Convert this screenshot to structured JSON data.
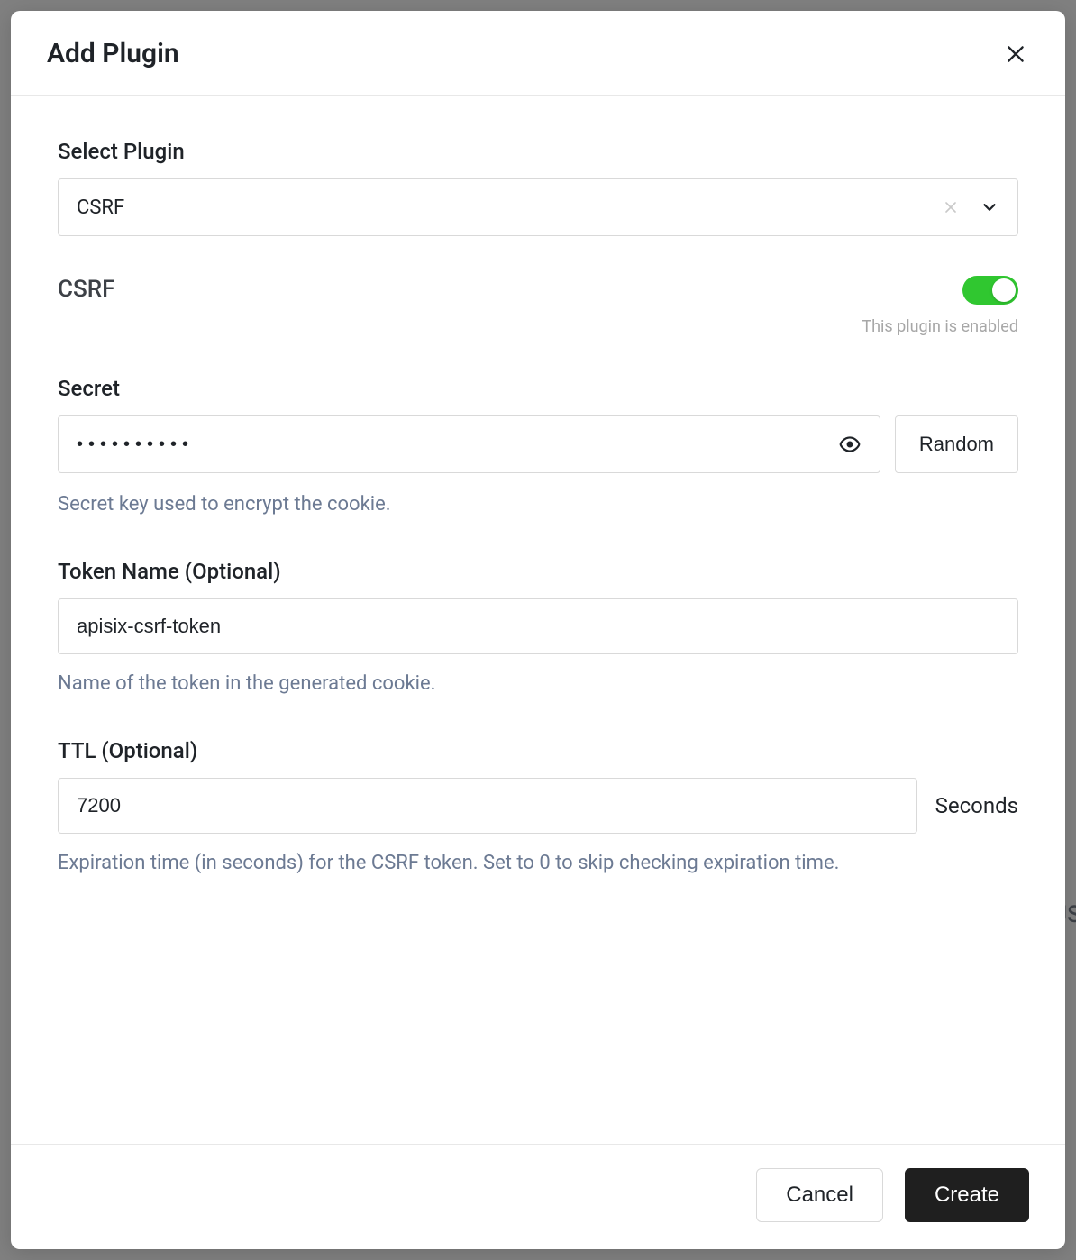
{
  "modal": {
    "title": "Add Plugin"
  },
  "select_plugin": {
    "label": "Select Plugin",
    "value": "CSRF"
  },
  "plugin_header": {
    "name": "CSRF",
    "enabled_hint": "This plugin is enabled"
  },
  "secret": {
    "label": "Secret",
    "value": "••••••••••",
    "random_label": "Random",
    "hint": "Secret key used to encrypt the cookie."
  },
  "token_name": {
    "label": "Token Name (Optional)",
    "value": "apisix-csrf-token",
    "hint": "Name of the token in the generated cookie."
  },
  "ttl": {
    "label": "TTL (Optional)",
    "value": "7200",
    "unit": "Seconds",
    "hint": "Expiration time (in seconds) for the CSRF token. Set to 0 to skip checking expiration time."
  },
  "footer": {
    "cancel": "Cancel",
    "create": "Create"
  },
  "bg_fragment": "JS"
}
